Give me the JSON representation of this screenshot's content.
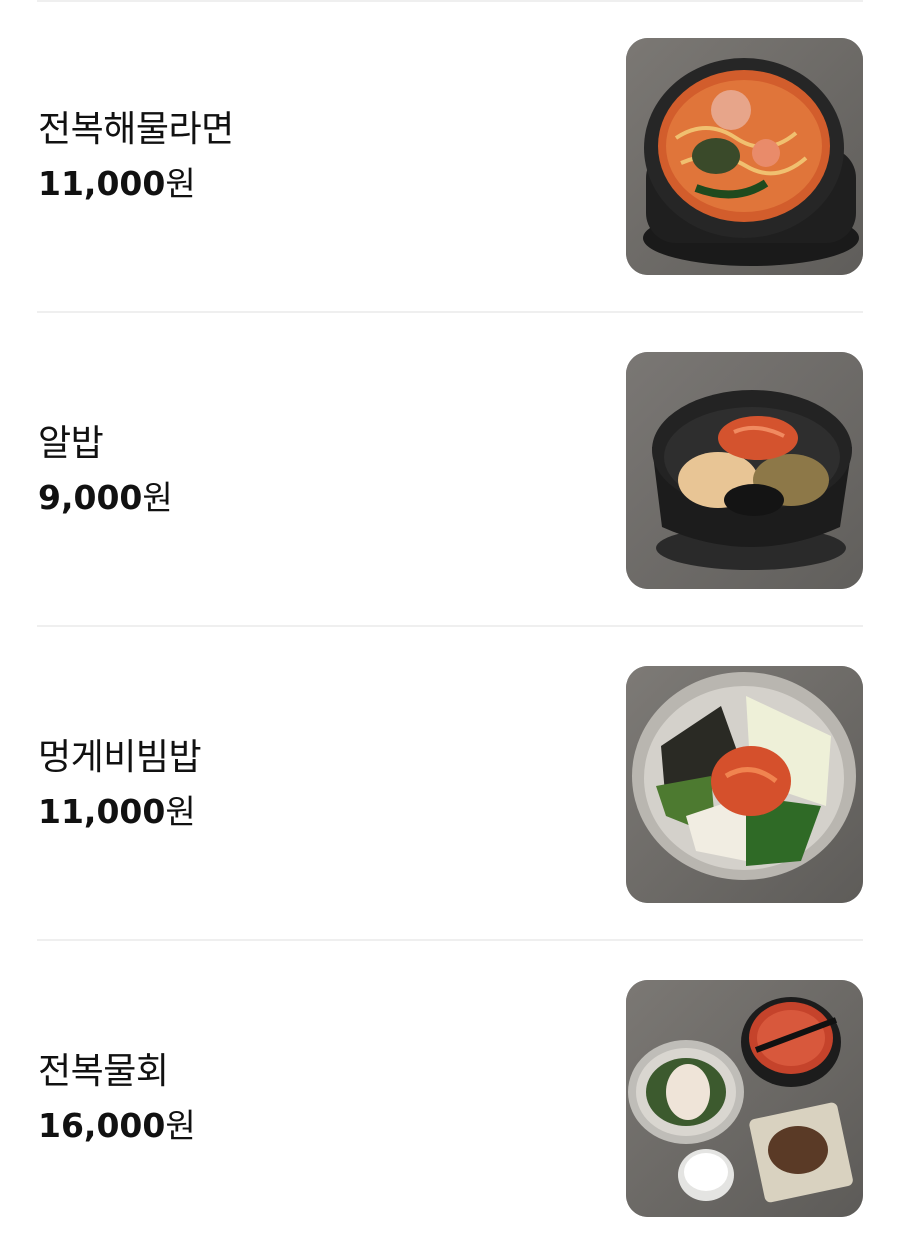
{
  "menu": {
    "items": [
      {
        "name": "전복해물라면",
        "price": "11,000",
        "currency": "원",
        "photo_icon": "ramen-in-stone-pot-photo"
      },
      {
        "name": "알밥",
        "price": "9,000",
        "currency": "원",
        "photo_icon": "fish-roe-rice-bowl-photo"
      },
      {
        "name": "멍게비빔밥",
        "price": "11,000",
        "currency": "원",
        "photo_icon": "sea-squirt-bibimbap-photo"
      },
      {
        "name": "전복물회",
        "price": "16,000",
        "currency": "원",
        "photo_icon": "abalone-cold-raw-fish-soup-photo"
      }
    ]
  },
  "colors": {
    "divider": "#efefef",
    "text": "#111111",
    "background": "#ffffff"
  }
}
